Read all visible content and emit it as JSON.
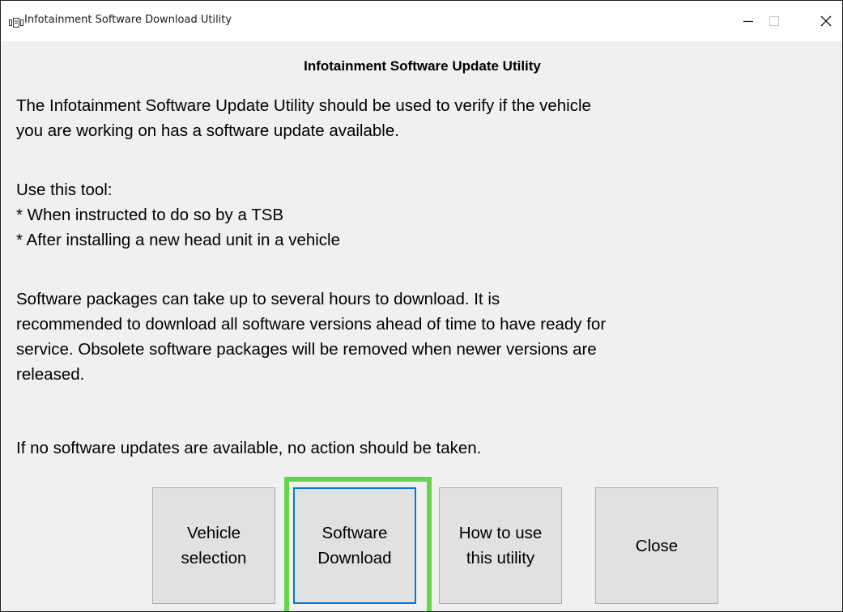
{
  "window": {
    "title": "Infotainment Software Download Utility",
    "controls": {
      "minimize_icon": "minimize-icon",
      "maximize_icon": "maximize-icon",
      "close_icon": "close-icon"
    }
  },
  "content": {
    "heading": "Infotainment Software Update Utility",
    "intro_lines": [
      "The Infotainment Software Update Utility should be used to verify if the vehicle",
      "you are working on has a software update available."
    ],
    "usage_lines": [
      "Use this tool:",
      "* When instructed to do so by a TSB",
      "* After installing a new head unit in a vehicle"
    ],
    "packages_lines": [
      "Software packages can take up to several hours to download.  It is",
      "recommended to download all software versions ahead of time to have ready for",
      "service.  Obsolete software packages will be removed when newer versions are",
      "released."
    ],
    "no_action_line": "If no software updates are available, no action should be taken."
  },
  "buttons": {
    "vehicle_selection": [
      "Vehicle",
      "selection"
    ],
    "software_download": [
      "Software",
      "Download"
    ],
    "how_to_use": [
      "How to use",
      "this utility"
    ],
    "close": "Close"
  },
  "colors": {
    "focus_border": "#0078d7",
    "highlight": "#66d44a",
    "button_face": "#e1e1e1",
    "dialog_bg": "#f0f0f0"
  }
}
